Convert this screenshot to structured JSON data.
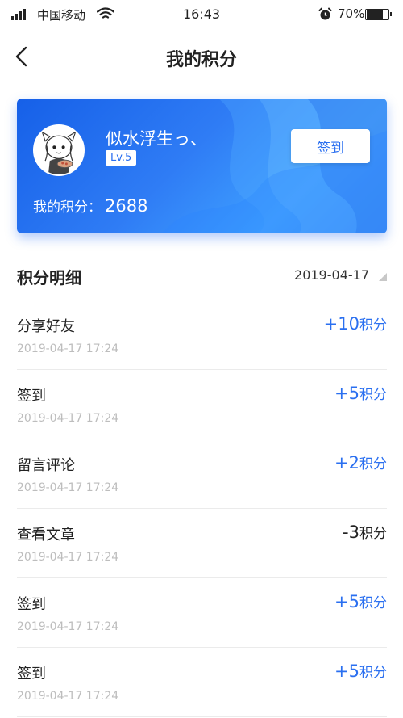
{
  "status_bar": {
    "carrier": "中国移动",
    "time": "16:43",
    "battery": "70%",
    "battery_level": 0.7,
    "icons": [
      "signal-icon",
      "wifi-icon",
      "alarm-icon",
      "battery-icon"
    ]
  },
  "navbar": {
    "title": "我的积分",
    "back_icon": "chevron-left-icon"
  },
  "card": {
    "username": "似水浮生っ、",
    "level": "Lv.5",
    "signin_label": "签到",
    "points_label": "我的积分：",
    "points_value": "2688"
  },
  "section": {
    "title": "积分明细",
    "date_filter": "2019-04-17"
  },
  "records": [
    {
      "title": "分享好友",
      "time": "2019-04-17  17:24",
      "points": "+10",
      "unit": "积分",
      "positive": true
    },
    {
      "title": "签到",
      "time": "2019-04-17  17:24",
      "points": "+5",
      "unit": "积分",
      "positive": true
    },
    {
      "title": "留言评论",
      "time": "2019-04-17  17:24",
      "points": "+2",
      "unit": "积分",
      "positive": true
    },
    {
      "title": "查看文章",
      "time": "2019-04-17  17:24",
      "points": "-3",
      "unit": "积分",
      "positive": false
    },
    {
      "title": "签到",
      "time": "2019-04-17  17:24",
      "points": "+5",
      "unit": "积分",
      "positive": true
    },
    {
      "title": "签到",
      "time": "2019-04-17  17:24",
      "points": "+5",
      "unit": "积分",
      "positive": true
    }
  ],
  "colors": {
    "accent": "#2a6ff0",
    "card_gradient_start": "#1660e8",
    "card_gradient_end": "#3fa0ff",
    "muted_text": "#bdbdbd"
  }
}
